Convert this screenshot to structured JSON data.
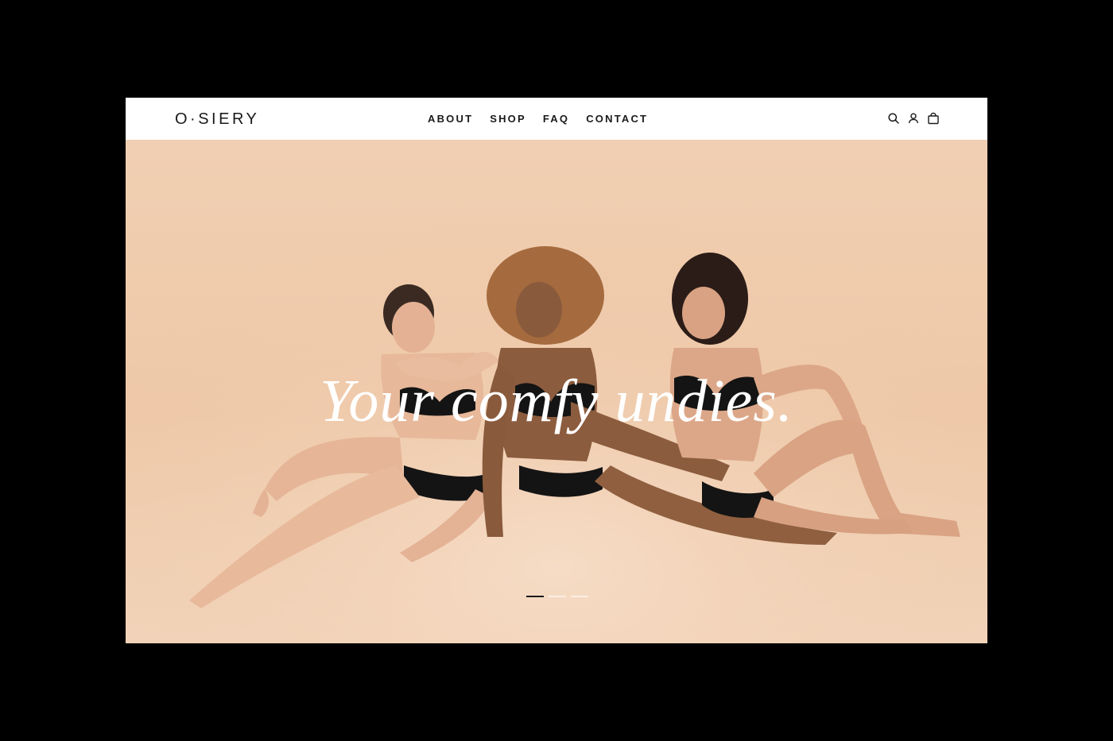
{
  "header": {
    "logo": "O·SIERY",
    "nav": [
      "ABOUT",
      "SHOP",
      "FAQ",
      "CONTACT"
    ],
    "icons": [
      "search-icon",
      "account-icon",
      "cart-icon"
    ]
  },
  "hero": {
    "headline": "Your comfy undies.",
    "slides_total": 3,
    "active_slide": 1
  },
  "colors": {
    "background": "#000000",
    "header_bg": "#ffffff",
    "text": "#1a1a1a",
    "hero_bg": "#efcaa9",
    "garment": "#111111"
  }
}
